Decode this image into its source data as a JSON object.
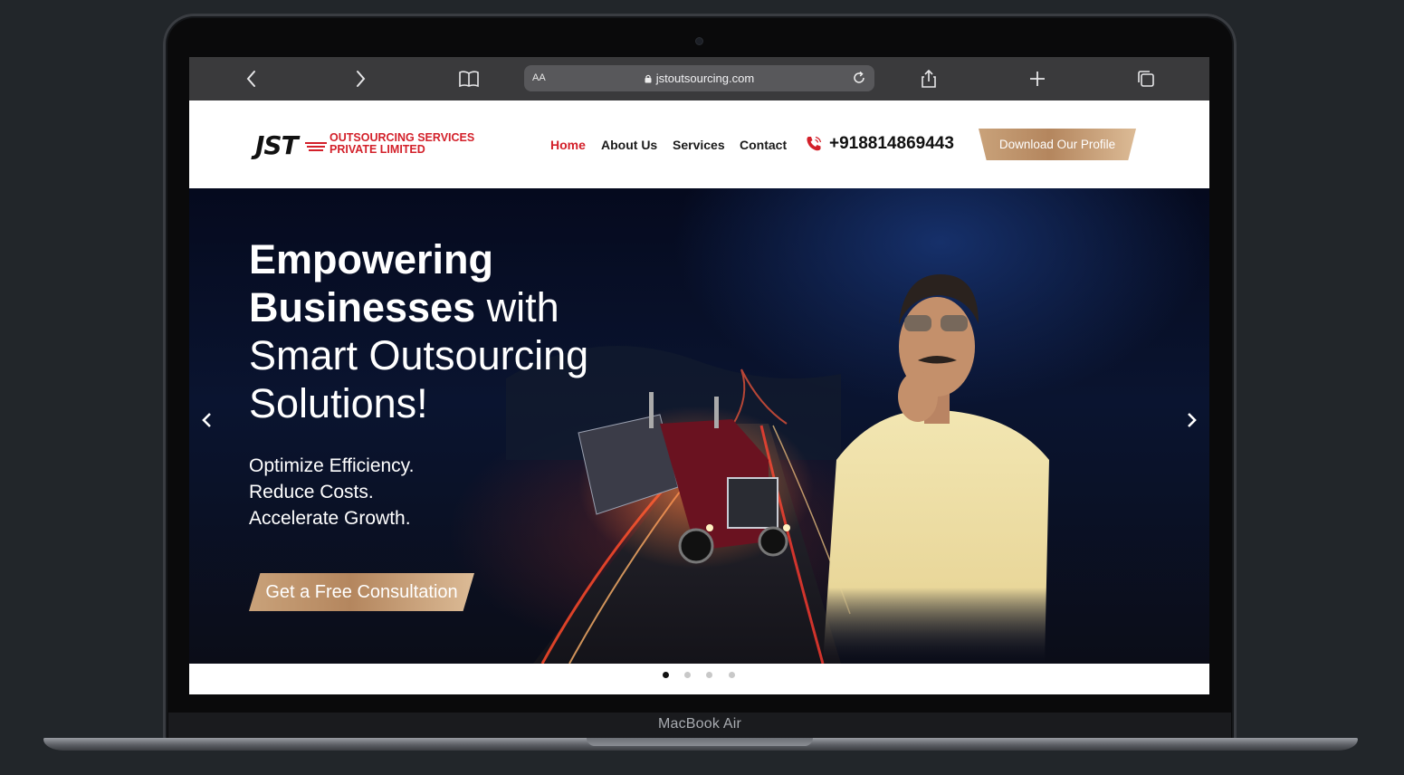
{
  "device": {
    "label": "MacBook Air"
  },
  "browser": {
    "aa_label": "AA",
    "url": "jstoutsourcing.com",
    "icons": [
      "back-icon",
      "forward-icon",
      "bookmarks-icon",
      "lock-icon",
      "reload-icon",
      "share-icon",
      "new-tab-icon",
      "tabs-icon"
    ]
  },
  "header": {
    "logo": {
      "mark": "JST",
      "line1": "OUTSOURCING SERVICES",
      "line2": "PRIVATE LIMITED"
    },
    "nav": [
      {
        "label": "Home",
        "active": true
      },
      {
        "label": "About Us",
        "active": false
      },
      {
        "label": "Services",
        "active": false
      },
      {
        "label": "Contact",
        "active": false
      }
    ],
    "phone": "+918814869443",
    "profile_button": "Download Our Profile"
  },
  "hero": {
    "title_bold_1": "Empowering",
    "title_bold_2": "Businesses",
    "title_light_1": " with",
    "title_light_2": "Smart Outsourcing",
    "title_light_3": "Solutions!",
    "taglines": [
      "Optimize Efficiency.",
      "Reduce Costs.",
      "Accelerate Growth."
    ],
    "cta": "Get a Free Consultation",
    "slides_total": 4,
    "active_slide": 1
  },
  "colors": {
    "accent_red": "#d3202a",
    "gold": "#c29a72",
    "browser_bar": "#3a3a3c"
  }
}
